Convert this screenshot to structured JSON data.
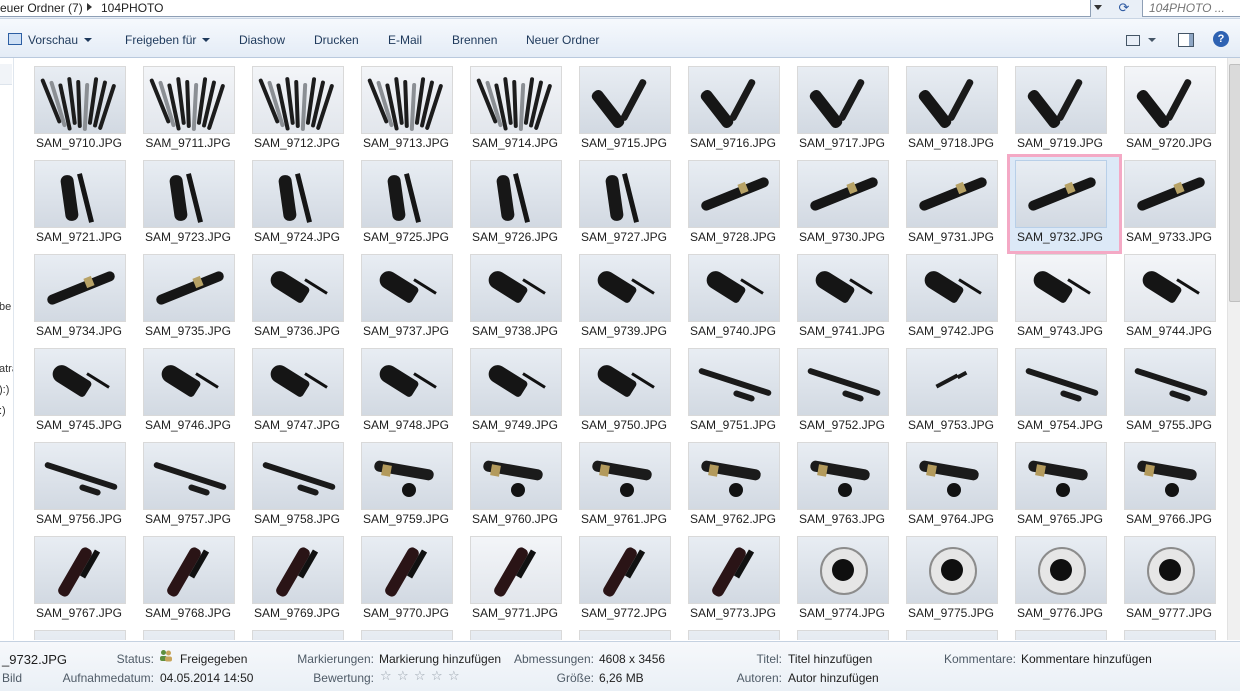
{
  "address": {
    "crumb_parent": "euer Ordner (7)",
    "crumb_current": "104PHOTO",
    "search_placeholder": "104PHOTO ..."
  },
  "toolbar": {
    "organize": "Vorschau",
    "share": "Freigeben für",
    "slideshow": "Diashow",
    "print": "Drucken",
    "email": "E-Mail",
    "burn": "Brennen",
    "new_folder": "Neuer Ordner"
  },
  "nav_fragments": [
    "be",
    "atra",
    "):)",
    ":)"
  ],
  "files": [
    "SAM_9710.JPG",
    "SAM_9711.JPG",
    "SAM_9712.JPG",
    "SAM_9713.JPG",
    "SAM_9714.JPG",
    "SAM_9715.JPG",
    "SAM_9716.JPG",
    "SAM_9717.JPG",
    "SAM_9718.JPG",
    "SAM_9719.JPG",
    "SAM_9720.JPG",
    "SAM_9721.JPG",
    "SAM_9723.JPG",
    "SAM_9724.JPG",
    "SAM_9725.JPG",
    "SAM_9726.JPG",
    "SAM_9727.JPG",
    "SAM_9728.JPG",
    "SAM_9730.JPG",
    "SAM_9731.JPG",
    "SAM_9732.JPG",
    "SAM_9733.JPG",
    "SAM_9734.JPG",
    "SAM_9735.JPG",
    "SAM_9736.JPG",
    "SAM_9737.JPG",
    "SAM_9738.JPG",
    "SAM_9739.JPG",
    "SAM_9740.JPG",
    "SAM_9741.JPG",
    "SAM_9742.JPG",
    "SAM_9743.JPG",
    "SAM_9744.JPG",
    "SAM_9745.JPG",
    "SAM_9746.JPG",
    "SAM_9747.JPG",
    "SAM_9748.JPG",
    "SAM_9749.JPG",
    "SAM_9750.JPG",
    "SAM_9751.JPG",
    "SAM_9752.JPG",
    "SAM_9753.JPG",
    "SAM_9754.JPG",
    "SAM_9755.JPG",
    "SAM_9756.JPG",
    "SAM_9757.JPG",
    "SAM_9758.JPG",
    "SAM_9759.JPG",
    "SAM_9760.JPG",
    "SAM_9761.JPG",
    "SAM_9762.JPG",
    "SAM_9763.JPG",
    "SAM_9764.JPG",
    "SAM_9765.JPG",
    "SAM_9766.JPG",
    "SAM_9767.JPG",
    "SAM_9768.JPG",
    "SAM_9769.JPG",
    "SAM_9770.JPG",
    "SAM_9771.JPG",
    "SAM_9772.JPG",
    "SAM_9773.JPG",
    "SAM_9774.JPG",
    "SAM_9775.JPG",
    "SAM_9776.JPG",
    "SAM_9777.JPG"
  ],
  "selected_file": "SAM_9732.JPG",
  "details": {
    "filename": "_9732.JPG",
    "filetype": "Bild",
    "status_label": "Status:",
    "status_value": "Freigegeben",
    "date_label": "Aufnahmedatum:",
    "date_value": "04.05.2014 14:50",
    "tags_label": "Markierungen:",
    "tags_value": "Markierung hinzufügen",
    "rating_label": "Bewertung:",
    "rating_value": 0,
    "rating_max": 5,
    "dimensions_label": "Abmessungen:",
    "dimensions_value": "4608 x 3456",
    "size_label": "Größe:",
    "size_value": "6,26 MB",
    "title_label": "Titel:",
    "title_value": "Titel hinzufügen",
    "authors_label": "Autoren:",
    "authors_value": "Autor hinzufügen",
    "comments_label": "Kommentare:",
    "comments_value": "Kommentare hinzufügen"
  }
}
